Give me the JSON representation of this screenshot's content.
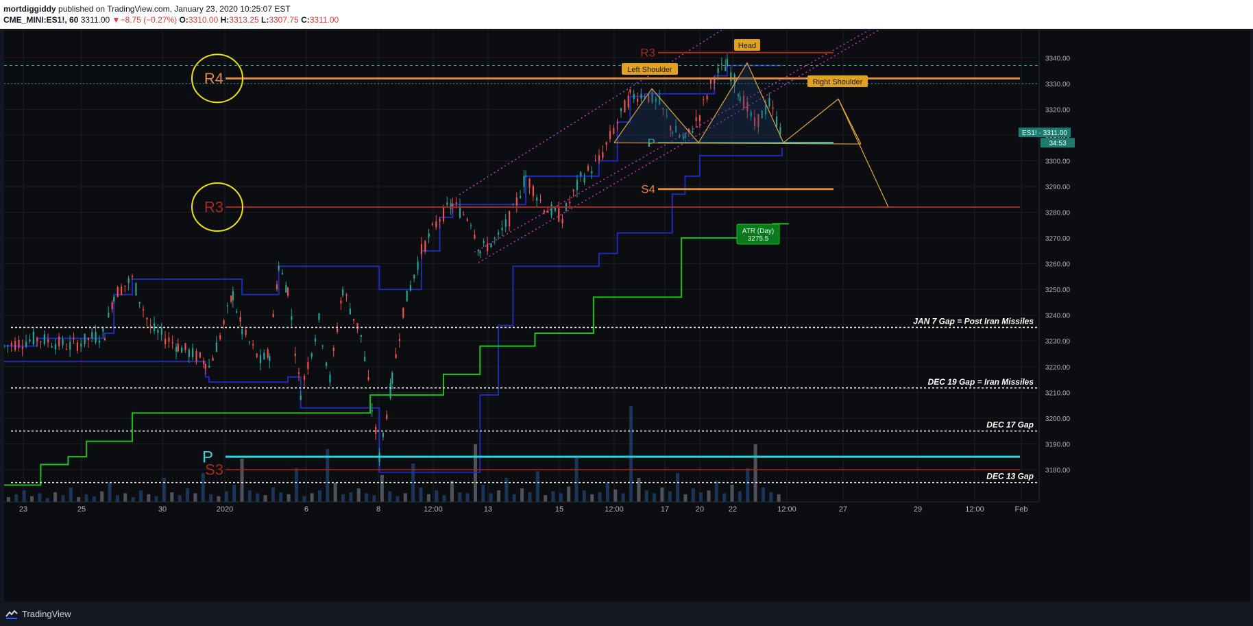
{
  "header": {
    "author": "mortdiggiddy",
    "published": "published on TradingView.com, January 23, 2020 10:25:07 EST",
    "symbol": "CME_MINI:ES1!, 60",
    "last": "3311.00",
    "change": "−8.75 (−0.27%)",
    "o_label": "O:",
    "o_value": "3310.00",
    "h_label": "H:",
    "h_value": "3313.25",
    "l_label": "L:",
    "l_value": "3307.75",
    "c_label": "C:",
    "c_value": "3311.00"
  },
  "footer": {
    "brand": "TradingView"
  },
  "colors": {
    "background": "#0c0d10",
    "candle_up": "#26a69a",
    "candle_down": "#ef5350",
    "channel": "#1e2bb8",
    "atr": "#19c419",
    "pivot_p": "#26d8e0",
    "r3": "#a8281c",
    "r4": "#e08a3c",
    "channel_dots": "#d030d0",
    "pattern": "#e0a83c",
    "gap_line": "#ffffff"
  },
  "chart_data": {
    "type": "candlestick",
    "symbol": "CME_MINI:ES1!",
    "interval": "60",
    "ylim": [
      3168,
      3347
    ],
    "y_ticks": [
      3180,
      3190,
      3200,
      3210,
      3220,
      3230,
      3240,
      3250,
      3260,
      3270,
      3280,
      3290,
      3300,
      3310,
      3320,
      3330,
      3340
    ],
    "x_ticks": [
      "23",
      "25",
      "30",
      "2020",
      "6",
      "8",
      "12:00",
      "13",
      "15",
      "12:00",
      "17",
      "20",
      "22",
      "12:00",
      "27",
      "29",
      "12:00",
      "Feb"
    ],
    "price_path": [
      [
        0,
        3228
      ],
      [
        18,
        3231
      ],
      [
        36,
        3228
      ],
      [
        55,
        3233
      ],
      [
        60,
        3248
      ],
      [
        70,
        3254
      ],
      [
        80,
        3235
      ],
      [
        95,
        3228
      ],
      [
        110,
        3222
      ],
      [
        112,
        3220
      ],
      [
        118,
        3232
      ],
      [
        125,
        3248
      ],
      [
        130,
        3234
      ],
      [
        140,
        3222
      ],
      [
        145,
        3225
      ],
      [
        150,
        3259
      ],
      [
        155,
        3250
      ],
      [
        162,
        3210
      ],
      [
        172,
        3238
      ],
      [
        178,
        3215
      ],
      [
        185,
        3250
      ],
      [
        195,
        3232
      ],
      [
        205,
        3185
      ],
      [
        212,
        3215
      ],
      [
        218,
        3242
      ],
      [
        228,
        3265
      ],
      [
        238,
        3278
      ],
      [
        245,
        3283
      ],
      [
        255,
        3277
      ],
      [
        260,
        3265
      ],
      [
        270,
        3270
      ],
      [
        278,
        3280
      ],
      [
        285,
        3294
      ],
      [
        295,
        3282
      ],
      [
        305,
        3278
      ],
      [
        315,
        3293
      ],
      [
        325,
        3300
      ],
      [
        335,
        3315
      ],
      [
        342,
        3325
      ],
      [
        350,
        3326
      ],
      [
        358,
        3322
      ],
      [
        365,
        3312
      ],
      [
        372,
        3308
      ],
      [
        380,
        3318
      ],
      [
        388,
        3333
      ],
      [
        395,
        3337
      ],
      [
        402,
        3326
      ],
      [
        410,
        3314
      ],
      [
        418,
        3322
      ],
      [
        425,
        3311
      ]
    ],
    "volume": [
      5,
      8,
      12,
      6,
      9,
      4,
      10,
      7,
      15,
      5,
      8,
      6,
      11,
      20,
      7,
      9,
      5,
      12,
      8,
      6,
      25,
      10,
      7,
      14,
      9,
      30,
      8,
      6,
      11,
      18,
      45,
      12,
      9,
      7,
      15,
      10,
      8,
      35,
      6,
      9,
      12,
      55,
      20,
      8,
      10,
      14,
      9,
      7,
      28,
      11,
      6,
      9,
      40,
      15,
      8,
      12,
      7,
      22,
      10,
      9,
      60,
      18,
      9,
      12,
      25,
      8,
      14,
      10,
      32,
      7,
      11,
      9,
      16,
      48,
      12,
      8,
      10,
      20,
      13,
      9,
      100,
      25,
      12,
      9,
      15,
      11,
      30,
      8,
      14,
      10,
      12,
      22,
      9,
      18,
      11,
      35,
      60,
      15,
      10,
      8
    ],
    "series": [
      {
        "name": "ATR (Day)",
        "last_value": 3275.5,
        "steps": [
          [
            0,
            3174
          ],
          [
            20,
            3182
          ],
          [
            35,
            3185
          ],
          [
            45,
            3191
          ],
          [
            70,
            3202
          ],
          [
            200,
            3209
          ],
          [
            240,
            3217
          ],
          [
            260,
            3228
          ],
          [
            290,
            3233
          ],
          [
            322,
            3247
          ],
          [
            370,
            3270
          ],
          [
            420,
            3275.5
          ]
        ]
      }
    ],
    "levels": [
      {
        "label": "R4",
        "price": 3332
      },
      {
        "label": "R3",
        "price": 3282
      },
      {
        "label": "R3",
        "price": 3342
      },
      {
        "label": "P",
        "price": 3307
      },
      {
        "label": "S4",
        "price": 3289
      },
      {
        "label": "P",
        "price": 3185
      },
      {
        "label": "S3",
        "price": 3180
      }
    ],
    "gaps": [
      {
        "label": "JAN 7 Gap = Post Iran Missiles",
        "price": 3235.25,
        "price_label": "3235.25"
      },
      {
        "label": "DEC 19 Gap = Iran Missiles",
        "price": 3211.75,
        "price_label": "3211.75"
      },
      {
        "label": "DEC 17 Gap",
        "price": 3195.0,
        "price_label": "3195.00"
      },
      {
        "label": "DEC 13 Gap",
        "price": 3175.0,
        "price_label": "3175.00"
      }
    ],
    "annotations": [
      "Head",
      "Left Shoulder",
      "Right Shoulder"
    ],
    "price_tag": {
      "label": "ES1! · 3311.00",
      "countdown": "34:53"
    }
  }
}
